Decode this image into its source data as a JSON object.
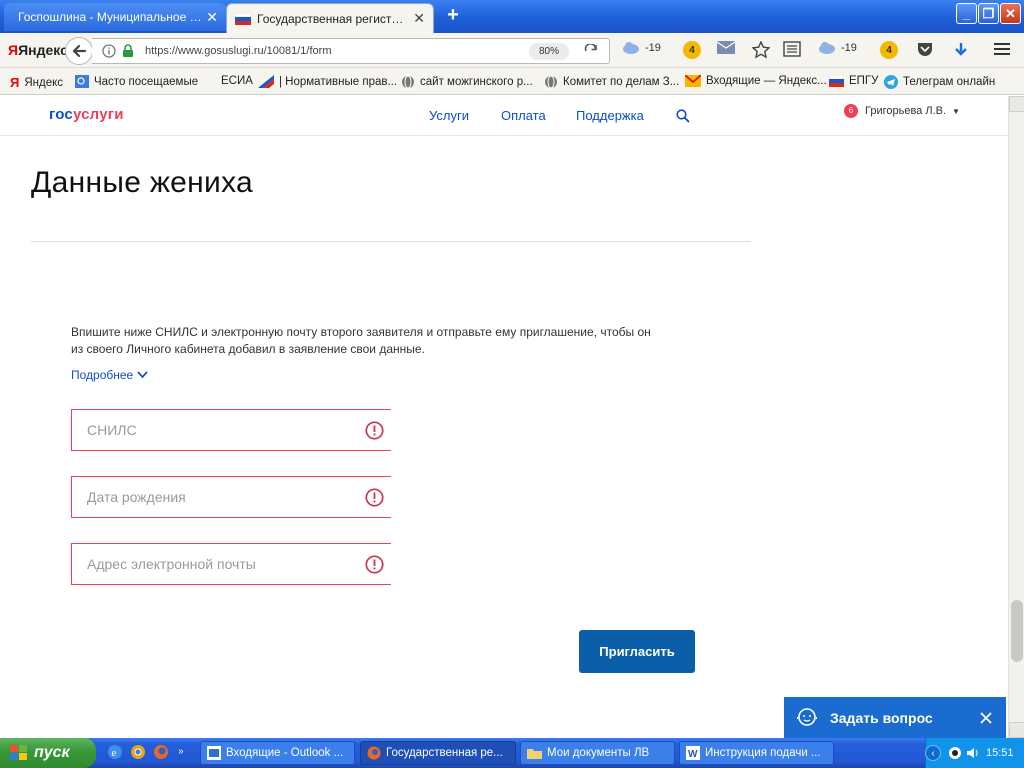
{
  "browser": {
    "tabs": [
      {
        "label": "Госпошлина - Муниципальное о..."
      },
      {
        "label": "Государственная регистра..."
      }
    ],
    "yandex_brand": "Яндекс",
    "url": "https://www.gosuslugi.ru/10081/1/form",
    "zoom": "80%",
    "toolbar_items": {
      "weather1": "-19",
      "mail_count1": "4",
      "weather2": "-19",
      "mail_count2": "4"
    },
    "bookmarks": [
      "Яндекс",
      "Часто посещаемые",
      "ЕСИА",
      "| Нормативные прав...",
      "сайт можгинского р...",
      "Комитет по делам З...",
      "Входящие — Яндекс...",
      "ЕПГУ",
      "Телеграм онлайн"
    ]
  },
  "site": {
    "logo_a": "гос",
    "logo_b": "услуги",
    "nav": [
      "Услуги",
      "Оплата",
      "Поддержка"
    ],
    "notifications": "6",
    "user": "Григорьева Л.В."
  },
  "page": {
    "title": "Данные жениха",
    "intro": "Впишите ниже СНИЛС и электронную почту второго заявителя и отправьте ему приглашение, чтобы он из своего Личного кабинета добавил в заявление свои данные.",
    "more": "Подробнее",
    "fields": [
      {
        "placeholder": "СНИЛС",
        "value": ""
      },
      {
        "placeholder": "Дата рождения",
        "value": ""
      },
      {
        "placeholder": "Адрес электронной почты",
        "value": ""
      }
    ],
    "invite_button": "Пригласить"
  },
  "chat": {
    "label": "Задать вопрос"
  },
  "taskbar": {
    "start": "пуск",
    "tasks": [
      {
        "label": "Входящие - Outlook ..."
      },
      {
        "label": "Государственная ре..."
      },
      {
        "label": "Мои документы ЛВ"
      },
      {
        "label": "Инструкция подачи ..."
      }
    ],
    "clock": "15:51"
  },
  "colors": {
    "accent": "#0d4cd3",
    "error": "#ee3f58",
    "button": "#0b5fa8",
    "chat": "#1b6cd1"
  }
}
